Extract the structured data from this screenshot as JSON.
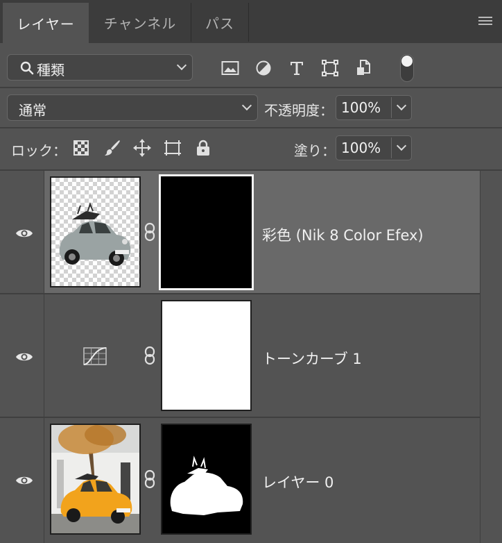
{
  "tabs": [
    {
      "label": "レイヤー",
      "active": true
    },
    {
      "label": "チャンネル",
      "active": false
    },
    {
      "label": "パス",
      "active": false
    }
  ],
  "filter": {
    "kind_label": "種類",
    "icons": [
      "image-filter-icon",
      "adjustment-filter-icon",
      "type-filter-icon",
      "shape-filter-icon",
      "smart-object-filter-icon",
      "filter-toggle"
    ]
  },
  "blend": {
    "mode": "通常",
    "opacity_label": "不透明度：",
    "opacity_value": "100%"
  },
  "lock": {
    "label": "ロック：",
    "icons": [
      "lock-transparent-pixels-icon",
      "lock-image-pixels-icon",
      "lock-position-icon",
      "lock-artboard-icon",
      "lock-all-icon"
    ],
    "fill_label": "塗り：",
    "fill_value": "100%"
  },
  "layers": [
    {
      "name": "彩色 (Nik 8 Color Efex)",
      "visible": true,
      "selected": true,
      "mask": "black"
    },
    {
      "name": "トーンカーブ 1",
      "visible": true,
      "selected": false,
      "mask": "white"
    },
    {
      "name": "レイヤー 0",
      "visible": true,
      "selected": false,
      "mask": "car-silhouette"
    }
  ],
  "colors": {
    "panel_bg": "#535353",
    "tabbar_bg": "#3c3c3c",
    "selected_row": "#696969",
    "car_yellow": "#f2a31c"
  }
}
